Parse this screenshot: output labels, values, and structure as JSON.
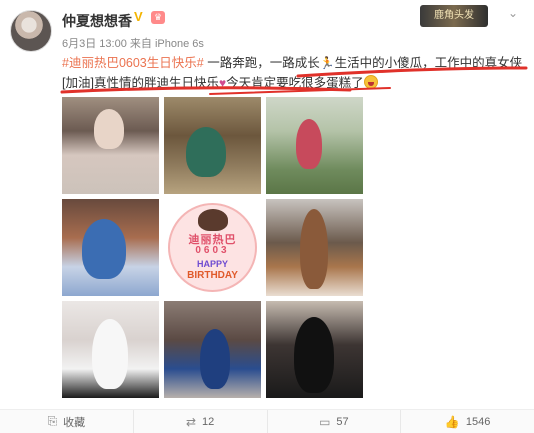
{
  "post": {
    "author": "仲夏想想香",
    "vip_icon": "vip-v-icon",
    "member_icon": "member-badge-icon",
    "member_label": "♛",
    "timestamp": "6月3日 13:00",
    "source": "来自 iPhone 6s",
    "header_decoration": "card-decoration-badge",
    "header_decoration_label": "鹿角头发",
    "more_icon": "chevron-down-icon",
    "text": {
      "hashtag": "#迪丽热巴0603生日快乐#",
      "part1": " 一路奔跑，一路成长",
      "runner_icon": "runner-emoji-icon",
      "part2": "生活中的小傻瓜，工作中的真女侠",
      "emoji1": "[加油]",
      "part3": "真性情的胖迪生日快乐",
      "emoji2": "heart-emoji-icon",
      "part4": "今天肯定要吃很多蛋糕了",
      "emoji3": "laugh-face-emoji-icon"
    },
    "birthday_graphic": {
      "name": "迪丽热巴",
      "date": "0603",
      "happy": "HAPPY",
      "birthday": "BIRTHDAY"
    }
  },
  "actions": [
    {
      "icon": "share-icon",
      "label": "收藏"
    },
    {
      "icon": "repost-icon",
      "label": "12"
    },
    {
      "icon": "comment-icon",
      "label": "57"
    },
    {
      "icon": "like-icon",
      "label": "1546"
    }
  ],
  "colors": {
    "hashtag": "#eb7350",
    "scribble": "#e0312a",
    "text": "#333333",
    "meta": "#888888"
  }
}
